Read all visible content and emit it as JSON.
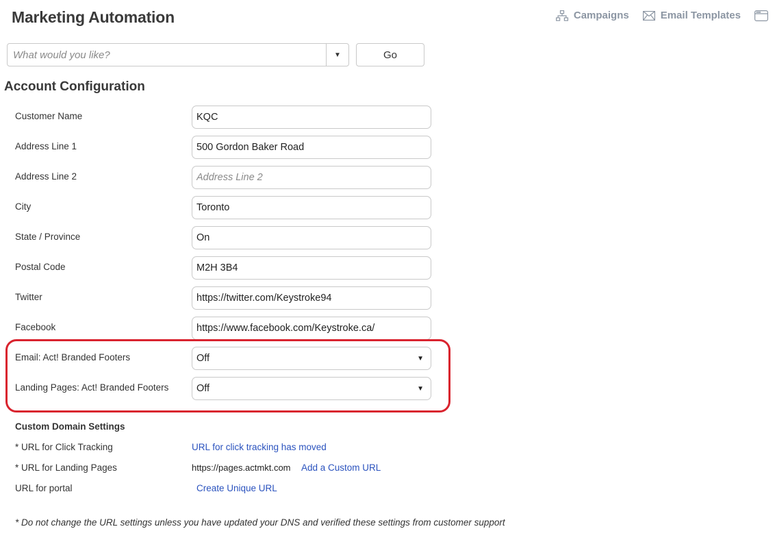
{
  "app": {
    "title": "Marketing Automation"
  },
  "nav": {
    "items": [
      {
        "label": "Campaigns",
        "icon": "sitemap-icon"
      },
      {
        "label": "Email Templates",
        "icon": "envelope-icon"
      },
      {
        "label": "",
        "icon": "window-icon"
      }
    ]
  },
  "command": {
    "placeholder": "What would you like?",
    "value": "",
    "go_label": "Go"
  },
  "section": {
    "title": "Account Configuration"
  },
  "form": {
    "fields": [
      {
        "label": "Customer Name",
        "value": "KQC",
        "placeholder": ""
      },
      {
        "label": "Address Line 1",
        "value": "500 Gordon Baker Road",
        "placeholder": ""
      },
      {
        "label": "Address Line 2",
        "value": "",
        "placeholder": "Address Line 2"
      },
      {
        "label": "City",
        "value": "Toronto",
        "placeholder": ""
      },
      {
        "label": "State / Province",
        "value": "On",
        "placeholder": ""
      },
      {
        "label": "Postal Code",
        "value": "M2H 3B4",
        "placeholder": ""
      },
      {
        "label": "Twitter",
        "value": "https://twitter.com/Keystroke94",
        "placeholder": ""
      },
      {
        "label": "Facebook",
        "value": "https://www.facebook.com/Keystroke.ca/",
        "placeholder": ""
      }
    ],
    "selects": [
      {
        "label": "Email: Act! Branded Footers",
        "value": "Off"
      },
      {
        "label": "Landing Pages: Act! Branded Footers",
        "value": "Off"
      }
    ]
  },
  "custom_domain": {
    "title": "Custom Domain Settings",
    "click_tracking": {
      "label": "* URL for Click Tracking",
      "link": "URL for click tracking has moved"
    },
    "landing_pages": {
      "label": "* URL for Landing Pages",
      "value": "https://pages.actmkt.com",
      "link": "Add a Custom URL"
    },
    "portal": {
      "label": "URL for portal",
      "link": "Create Unique URL"
    }
  },
  "note": "* Do not change the URL settings unless you have updated your DNS and verified these settings from customer support",
  "colors": {
    "accent_link": "#2a52be",
    "highlight": "#d9232e",
    "nav_gray": "#8c96a3"
  }
}
